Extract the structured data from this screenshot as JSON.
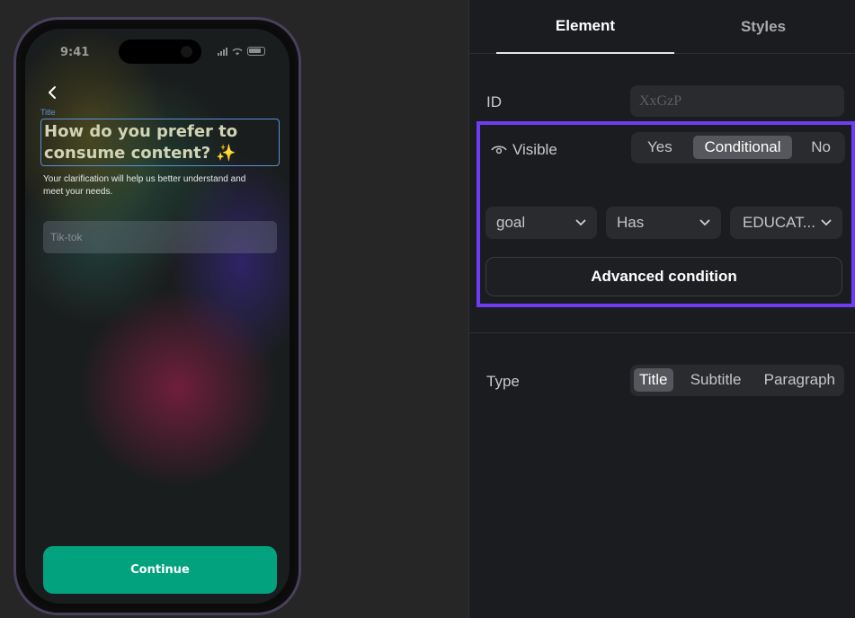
{
  "phone": {
    "status_time": "9:41",
    "title_tag": "Title",
    "title": "How do you prefer to consume content? ✨",
    "subtitle": "Your clarification will help us better understand and meet your needs.",
    "input_placeholder": "Tik-tok",
    "continue_label": "Continue"
  },
  "panel": {
    "tabs": [
      {
        "label": "Element",
        "active": true
      },
      {
        "label": "Styles",
        "active": false
      }
    ],
    "id": {
      "label": "ID",
      "placeholder": "XxGzP"
    },
    "visible": {
      "label": "Visible",
      "options": [
        "Yes",
        "Conditional",
        "No"
      ],
      "selected": "Conditional",
      "condition": {
        "field": "goal",
        "operator": "Has",
        "value": "EDUCAT..."
      },
      "advanced_label": "Advanced condition"
    },
    "type": {
      "label": "Type",
      "options": [
        "Title",
        "Subtitle",
        "Paragraph"
      ],
      "selected": "Title"
    }
  },
  "colors": {
    "accent_outline": "#6c3df2",
    "continue_button": "#02a27f",
    "title_selection": "#5a8fd8"
  },
  "icons": [
    "back-chevron-icon",
    "eye-icon",
    "chevron-down-icon",
    "signal-icon",
    "wifi-icon",
    "battery-icon"
  ]
}
